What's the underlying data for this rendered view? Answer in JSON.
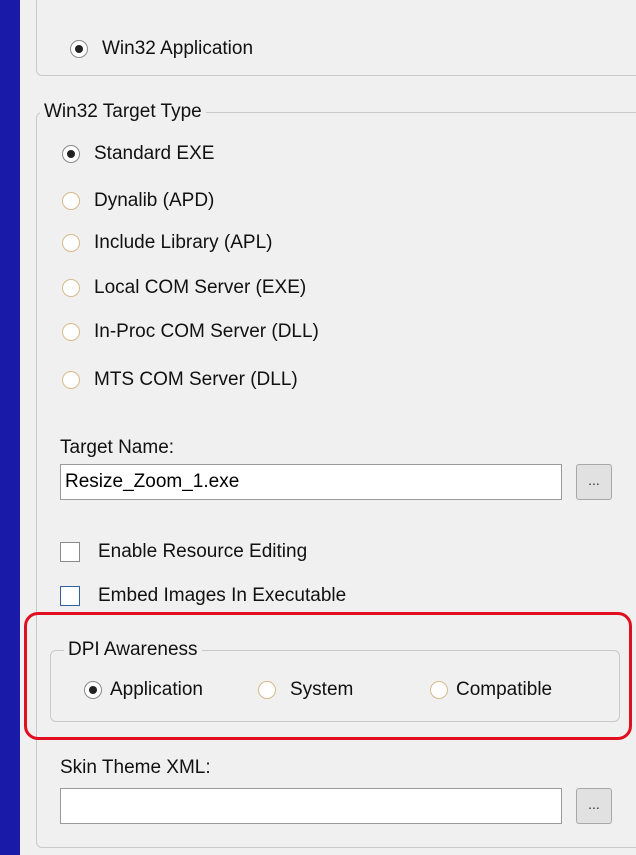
{
  "app_type": {
    "label": "Win32 Application",
    "checked": true
  },
  "target_type": {
    "title": "Win32 Target Type",
    "options": [
      {
        "label": "Standard EXE",
        "checked": true
      },
      {
        "label": "Dynalib (APD)",
        "checked": false
      },
      {
        "label": "Include Library (APL)",
        "checked": false
      },
      {
        "label": "Local COM Server (EXE)",
        "checked": false
      },
      {
        "label": "In-Proc COM Server (DLL)",
        "checked": false
      },
      {
        "label": "MTS COM Server (DLL)",
        "checked": false
      }
    ]
  },
  "target_name": {
    "label": "Target Name:",
    "value": "Resize_Zoom_1.exe",
    "browse_label": "..."
  },
  "checkboxes": [
    {
      "label": "Enable Resource Editing",
      "checked": false
    },
    {
      "label": "Embed Images In Executable",
      "checked": true
    }
  ],
  "dpi": {
    "title": "DPI Awareness",
    "options": [
      {
        "label": "Application",
        "checked": true
      },
      {
        "label": "System",
        "checked": false
      },
      {
        "label": "Compatible",
        "checked": false
      }
    ]
  },
  "skin_theme": {
    "label": "Skin Theme XML:",
    "value": "",
    "browse_label": "..."
  },
  "colors": {
    "background": "#1a1aa8",
    "highlight": "#e01020",
    "checkbox_accent": "#2f5f9c"
  }
}
